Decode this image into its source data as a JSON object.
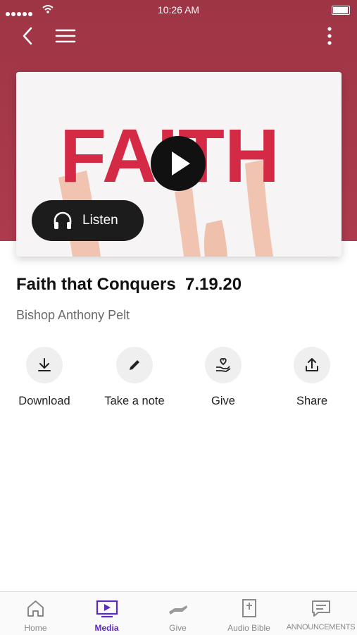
{
  "status_bar": {
    "time": "10:26 AM"
  },
  "header": {
    "back_icon": "chevron-left-icon",
    "menu_icon": "hamburger-icon",
    "more_icon": "more-vertical-icon",
    "color": "#a6394a"
  },
  "media": {
    "thumbnail_text": "FAITH",
    "listen_label": "Listen",
    "title": "Faith that Conquers  7.19.20",
    "speaker": "Bishop Anthony Pelt"
  },
  "actions": [
    {
      "label": "Download",
      "icon": "download-icon"
    },
    {
      "label": "Take a note",
      "icon": "pencil-icon"
    },
    {
      "label": "Give",
      "icon": "hand-heart-icon"
    },
    {
      "label": "Share",
      "icon": "share-icon"
    }
  ],
  "tabs": [
    {
      "label": "Home",
      "icon": "home-icon",
      "active": false
    },
    {
      "label": "Media",
      "icon": "media-play-icon",
      "active": true
    },
    {
      "label": "Give",
      "icon": "give-hand-icon",
      "active": false
    },
    {
      "label": "Audio Bible",
      "icon": "bible-icon",
      "active": false
    },
    {
      "label": "ANNOUNCEMENTS",
      "icon": "message-icon",
      "active": false
    }
  ],
  "colors": {
    "accent": "#5b2bbd",
    "brand": "#a6394a",
    "letters": "#d42a45"
  }
}
